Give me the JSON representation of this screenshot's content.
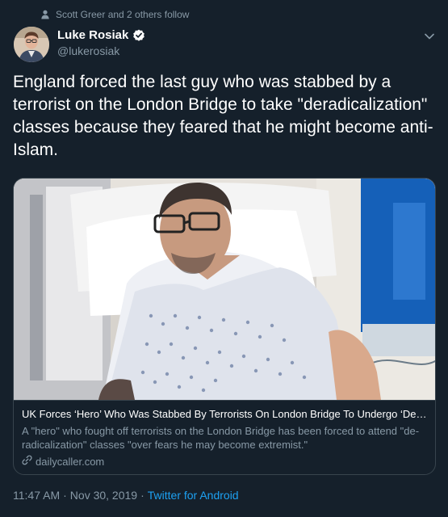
{
  "social_context": "Scott Greer and 2 others follow",
  "author": {
    "name": "Luke Rosiak",
    "handle": "@lukerosiak"
  },
  "tweet_text": "England forced the last guy who was stabbed by a terrorist on the London Bridge to take \"deradicalization\" classes because they feared that he might become anti-Islam.",
  "card": {
    "title": "UK Forces ‘Hero’ Who Was Stabbed By Terrorists On London Bridge To Undergo ‘De-Radicalization’ Classes",
    "description": "A \"hero\" who fought off terrorists on the London Bridge has been forced to attend \"de-radicalization\" classes \"over fears he may become extremist.\"",
    "domain": "dailycaller.com"
  },
  "meta": {
    "time": "11:47 AM",
    "separator": "·",
    "date": "Nov 30, 2019",
    "client": "Twitter for Android"
  },
  "colors": {
    "background": "#15202b",
    "secondary_text": "#8899a6",
    "link": "#1da1f2",
    "border": "#38444d"
  },
  "icons": {
    "social_context": "person-icon",
    "verified": "verified-badge-icon",
    "menu": "chevron-down-icon",
    "link": "link-icon"
  }
}
